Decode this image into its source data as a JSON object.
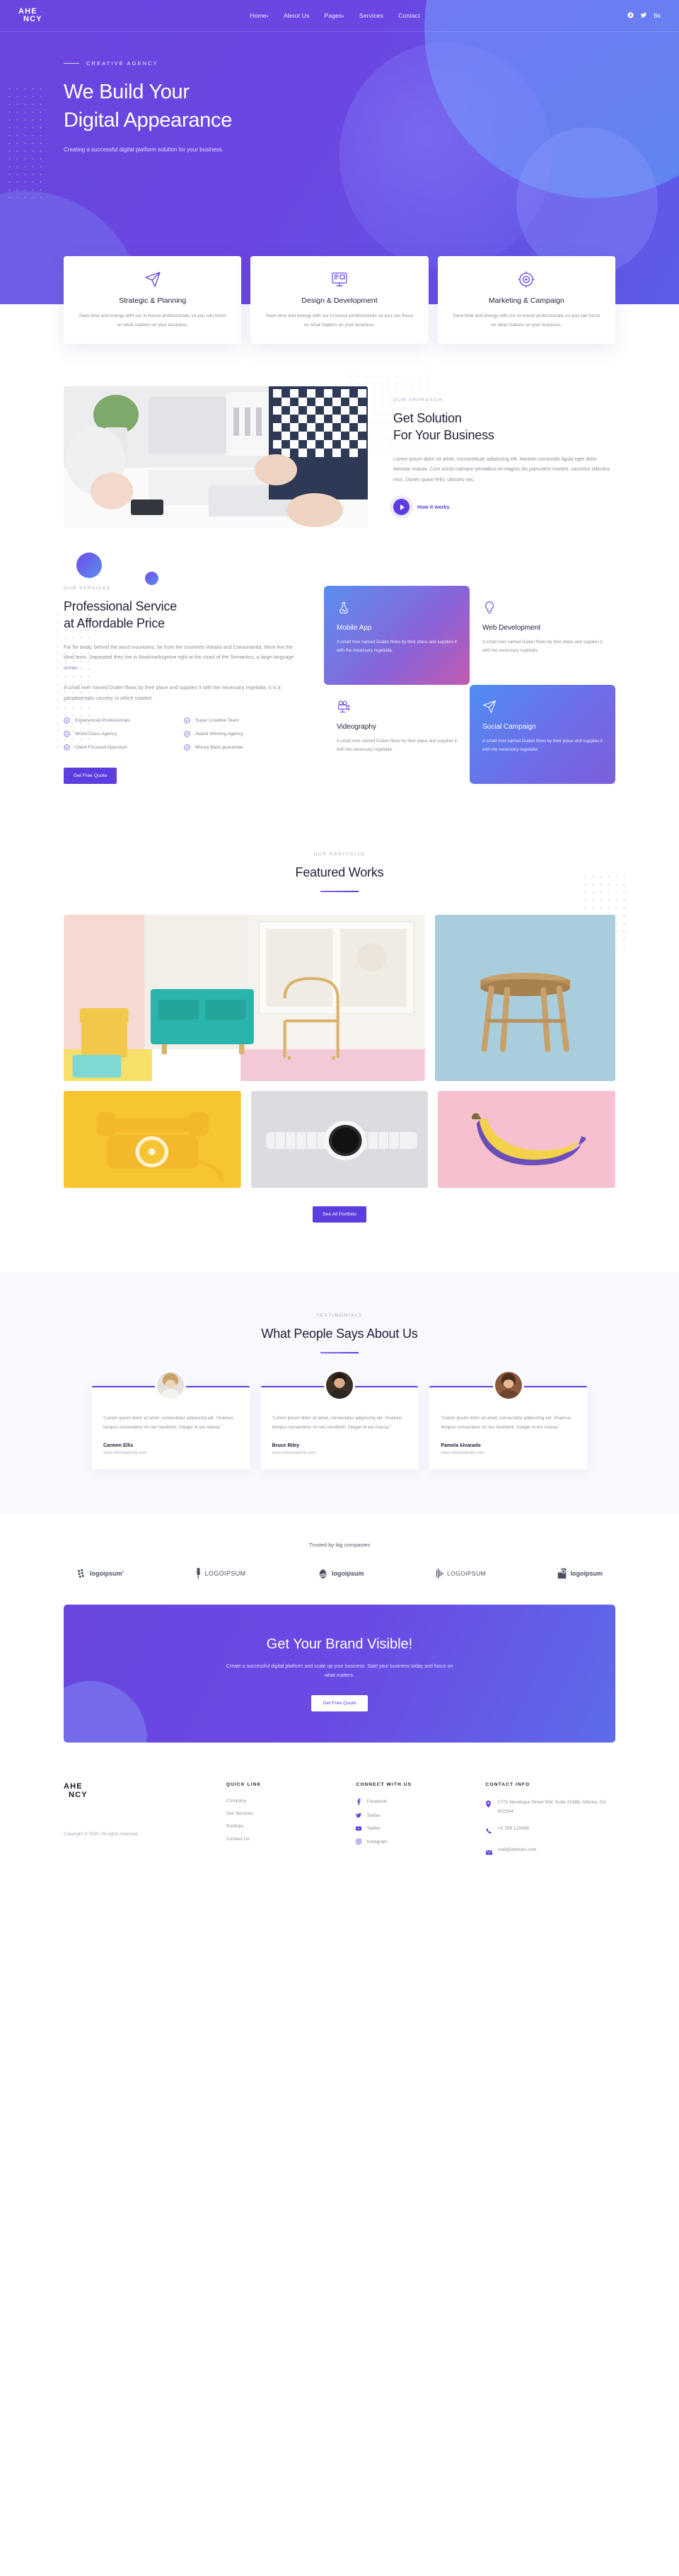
{
  "brand": {
    "line1": "AHE",
    "line2": "NCY"
  },
  "nav": {
    "items": [
      {
        "label": "Home",
        "caret": "▾"
      },
      {
        "label": "About Us",
        "caret": ""
      },
      {
        "label": "Pages",
        "caret": "▾"
      },
      {
        "label": "Services",
        "caret": ""
      },
      {
        "label": "Contact",
        "caret": ""
      }
    ],
    "social": [
      {
        "name": "facebook-icon",
        "glyph": "f"
      },
      {
        "name": "twitter-icon",
        "glyph": "t"
      },
      {
        "name": "behance-icon",
        "glyph": "Bē"
      }
    ]
  },
  "hero": {
    "eyebrow": "CREATIVE AGENCY",
    "title_line1": "We Build Your",
    "title_line2": "Digital Appearance",
    "subtitle": "Creating a successful digital platform solution for your business."
  },
  "features": [
    {
      "icon": "paper-plane-icon",
      "title": "Strategic & Planning",
      "text": "Save time and energy with our in-house professionals so you can focus on what matters on your business."
    },
    {
      "icon": "monitor-design-icon",
      "title": "Design & Development",
      "text": "Save time and energy with our in-house professionals so you can focus on what matters on your business."
    },
    {
      "icon": "target-icon",
      "title": "Marketing & Campaign",
      "text": "Save time and energy with our in-house professionals so you can focus on what matters on your business."
    }
  ],
  "approach": {
    "eyebrow": "OUR APPROACH",
    "title_line1": "Get Solution",
    "title_line2": "For Your Business",
    "body": "Lorem ipsum dolor sit amet, consectetuer adipiscing elit. Aenean commodo ligula eget dolor. Aenean massa. Cum sociis natoque penatibus et magnis dis parturient montes, nascetur ridiculus mus. Donec quam felis, ultricies nec,",
    "video_label": "How it works"
  },
  "services": {
    "eyebrow": "OUR SERVICES",
    "title_line1": "Professional Service",
    "title_line2": "at Affordable Price",
    "para1": "Far far away, behind the word mountains, far from the countries Vokalia and Consonantia, there live the blind texts. Separated they live in Bookmarksgrove right at the coast of the Semantics, a large language ocean.",
    "para2": "A small river named Duden flows by their place and supplies it with the necessary regelialia. It is a paradisematic country, in which roasted.",
    "checklist": [
      "Experienced Professionals",
      "Super Creative Team",
      "World-Class Agency",
      "Award Winning Agency",
      "Client Focused Approach",
      "Money Back guarantee"
    ],
    "cta_label": "Get Free Quote",
    "cards": [
      {
        "icon": "flask-icon",
        "title": "Mobile App",
        "text": "A small river named Duden flows by their place and supplies it with the necessary regelialia.",
        "style": "g1"
      },
      {
        "icon": "bulb-icon",
        "title": "Web Development",
        "text": "A small river named Duden flows by their place and supplies it with the necessary regelialia.",
        "style": "w"
      },
      {
        "icon": "video-camera-icon",
        "title": "Videography",
        "text": "A small river named Duden flows by their place and supplies it with the necessary regelialia.",
        "style": "w"
      },
      {
        "icon": "paper-plane-icon",
        "title": "Social Campaign",
        "text": "A small river named Duden flows by their place and supplies it with the necessary regelialia.",
        "style": "g2"
      }
    ]
  },
  "portfolio": {
    "eyebrow": "OUR PORTFOLIO",
    "title": "Featured Works",
    "button_label": "See All Portfolio",
    "tiles": [
      {
        "name": "interior-room",
        "bg": "#eef1f3"
      },
      {
        "name": "wooden-stool",
        "bg": "#a9cfdf"
      },
      {
        "name": "yellow-telephone",
        "bg": "#f6c531"
      },
      {
        "name": "smart-watch",
        "bg": "#d9dade"
      },
      {
        "name": "banana",
        "bg": "#f6c2cf"
      }
    ]
  },
  "testimonials": {
    "eyebrow": "TESTIMONIALS",
    "title": "What People Says About Us",
    "items": [
      {
        "quote": "“Lorem ipsum dolor sit amet, consectetur adipiscing elit. Vivamus tempus consectetur mi nec hendrerit. Integer id est massa.”",
        "name": "Carmen Ellis",
        "site": "www.clientwebsite.com",
        "avatar": "#cfc3b4"
      },
      {
        "quote": "“Lorem ipsum dolor sit amet, consectetur adipiscing elit. Vivamus tempus consectetur mi nec hendrerit. Integer id est massa.”",
        "name": "Bruce Riley",
        "site": "www.clientwebsite.com",
        "avatar": "#4a3a2c"
      },
      {
        "quote": "“Lorem ipsum dolor sit amet, consectetur adipiscing elit. Vivamus tempus consectetur mi nec hendrerit. Integer id est massa.”",
        "name": "Pamela Alvarado",
        "site": "www.clientwebsite.com",
        "avatar": "#8a5a3c"
      }
    ]
  },
  "clients": {
    "title": "Trusted by big companies",
    "logos": [
      {
        "name": "logoipsum-1",
        "text": "logoipsum’"
      },
      {
        "name": "logoipsum-2",
        "text": "LOGOIPSUM"
      },
      {
        "name": "logoipsum-3",
        "text": "logoipsum"
      },
      {
        "name": "logoipsum-4",
        "text": "LOGOIPSUM"
      },
      {
        "name": "logoipsum-5",
        "text": "logoipsum"
      }
    ]
  },
  "cta": {
    "title": "Get Your Brand Visible!",
    "text": "Create a successful digital platform and scale up your business. Start your business today and focus on what matters.",
    "button_label": "Get Free Quote"
  },
  "footer": {
    "copyright": "Copyright © 2020. All rights reserved.",
    "quick": {
      "heading": "QUICK LINK",
      "links": [
        "Company",
        "Our Services",
        "Portfolio",
        "Contact Us"
      ]
    },
    "connect": {
      "heading": "CONNECT WITH US",
      "links": [
        {
          "icon": "facebook-icon",
          "glyph": "f",
          "label": "Facebook"
        },
        {
          "icon": "twitter-icon",
          "glyph": "ᴛ",
          "label": "Twitter"
        },
        {
          "icon": "youtube-icon",
          "glyph": "▶",
          "label": "Twitter"
        },
        {
          "icon": "instagram-icon",
          "glyph": "▣",
          "label": "Instagram"
        }
      ]
    },
    "contact": {
      "heading": "CONTACT INFO",
      "address": "1772 Nevskaya Street NW, Suite 21389, Atlanta, GA 902344",
      "phone": "+1 789 123456",
      "email": "mail@domain.com"
    }
  },
  "colors": {
    "primary": "#5d3ce0",
    "hero_start": "#6a45e0",
    "hero_end": "#5d5ce8"
  }
}
